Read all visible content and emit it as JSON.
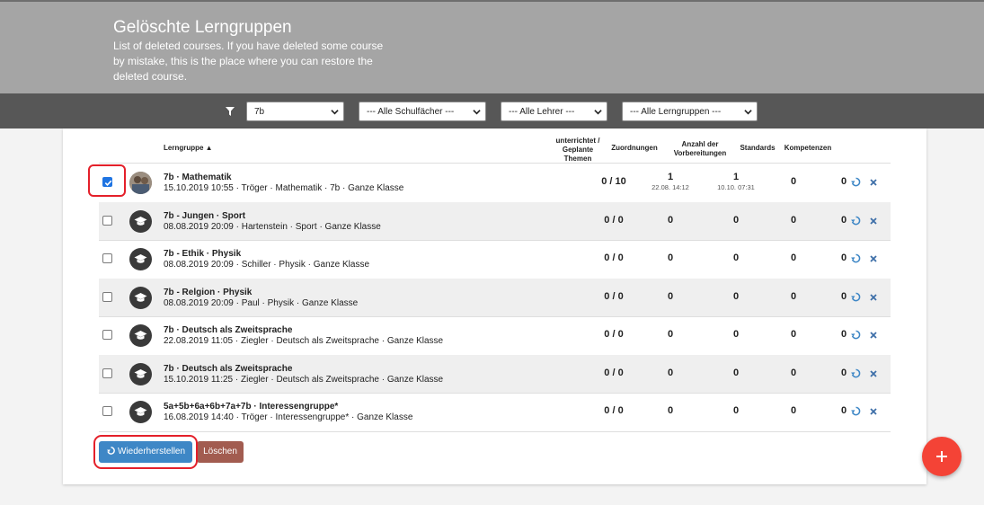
{
  "header": {
    "title": "Gelöschte Lerngruppen",
    "description": "List of deleted courses. If you have deleted some course by mistake, this is the place where you can restore the deleted course."
  },
  "filters": {
    "class_value": "7b",
    "subjects_value": "--- Alle Schulfächer ---",
    "teachers_value": "--- Alle Lehrer ---",
    "groups_value": "--- Alle Lerngruppen ---"
  },
  "table": {
    "headers": {
      "group": "Lerngruppe ▲",
      "taught": "unterrichtet / Geplante Themen",
      "assignments": "Zuordnungen",
      "preparations": "Anzahl der Vorbereitungen",
      "standards": "Standards",
      "competencies": "Kompetenzen"
    },
    "rows": [
      {
        "title": "7b · Mathematik",
        "subtitle": "15.10.2019 10:55 · Tröger · Mathematik · 7b · Ganze Klasse",
        "taught": "0 / 10",
        "assignments": "1",
        "assignments_date": "22.08. 14:12",
        "preparations": "1",
        "preparations_date": "10.10. 07:31",
        "standards": "0",
        "competencies": "0",
        "checked": true
      },
      {
        "title": "7b - Jungen · Sport",
        "subtitle": "08.08.2019 20:09 · Hartenstein · Sport · Ganze Klasse",
        "taught": "0 / 0",
        "assignments": "0",
        "assignments_date": "",
        "preparations": "0",
        "preparations_date": "",
        "standards": "0",
        "competencies": "0",
        "checked": false
      },
      {
        "title": "7b - Ethik · Physik",
        "subtitle": "08.08.2019 20:09 · Schiller · Physik · Ganze Klasse",
        "taught": "0 / 0",
        "assignments": "0",
        "assignments_date": "",
        "preparations": "0",
        "preparations_date": "",
        "standards": "0",
        "competencies": "0",
        "checked": false
      },
      {
        "title": "7b - Relgion · Physik",
        "subtitle": "08.08.2019 20:09 · Paul · Physik · Ganze Klasse",
        "taught": "0 / 0",
        "assignments": "0",
        "assignments_date": "",
        "preparations": "0",
        "preparations_date": "",
        "standards": "0",
        "competencies": "0",
        "checked": false
      },
      {
        "title": "7b · Deutsch als Zweitsprache",
        "subtitle": "22.08.2019 11:05 · Ziegler · Deutsch als Zweitsprache · Ganze Klasse",
        "taught": "0 / 0",
        "assignments": "0",
        "assignments_date": "",
        "preparations": "0",
        "preparations_date": "",
        "standards": "0",
        "competencies": "0",
        "checked": false
      },
      {
        "title": "7b · Deutsch als Zweitsprache",
        "subtitle": "15.10.2019 11:25 · Ziegler · Deutsch als Zweitsprache · Ganze Klasse",
        "taught": "0 / 0",
        "assignments": "0",
        "assignments_date": "",
        "preparations": "0",
        "preparations_date": "",
        "standards": "0",
        "competencies": "0",
        "checked": false
      },
      {
        "title": "5a+5b+6a+6b+7a+7b · Interessengruppe*",
        "subtitle": "16.08.2019 14:40 · Tröger · Interessengruppe* · Ganze Klasse",
        "taught": "0 / 0",
        "assignments": "0",
        "assignments_date": "",
        "preparations": "0",
        "preparations_date": "",
        "standards": "0",
        "competencies": "0",
        "checked": false
      }
    ]
  },
  "actions": {
    "restore_label": "Wiederherstellen",
    "delete_label": "Löschen"
  },
  "colors": {
    "header_bg": "#a5a5a5",
    "filterbar_bg": "#575757",
    "restore_button": "#3e87c6",
    "delete_button": "#a25c50",
    "fab": "#f44336",
    "highlight": "#e4202a"
  },
  "icons": {
    "filter": "filter-icon",
    "row_avatar": "graduation-cap-icon",
    "row_restore": "recycle-icon",
    "row_delete": "close-icon",
    "fab": "plus-icon"
  }
}
